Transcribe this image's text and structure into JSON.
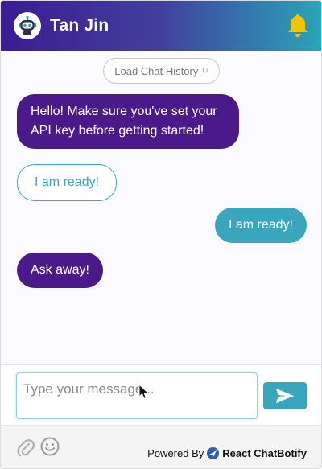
{
  "header": {
    "title": "Tan Jin",
    "avatar_icon": "robot-icon",
    "bell_icon": "bell-icon",
    "gradient_colors": [
      "#3c1b93",
      "#42409d",
      "#2aa5b8"
    ],
    "bell_color": "#f5c400"
  },
  "body": {
    "load_history_label": "Load Chat History",
    "load_history_icon": "↻",
    "messages": [
      {
        "sender": "bot",
        "text": "Hello! Make sure you've set your API key before getting started!"
      },
      {
        "sender": "option",
        "text": "I am ready!"
      },
      {
        "sender": "user",
        "text": "I am ready!"
      },
      {
        "sender": "bot",
        "text": "Ask away!"
      }
    ]
  },
  "input": {
    "placeholder": "Type your message...",
    "value": "",
    "send_icon": "send-icon"
  },
  "footer": {
    "attach_icon": "paperclip-icon",
    "emoji_icon": "emoji-icon",
    "powered_prefix": "Powered By",
    "brand": "React ChatBotify"
  },
  "colors": {
    "bot_bubble": "#4a1a8a",
    "user_bubble": "#3aa6bd",
    "accent": "#3aa6bd"
  }
}
